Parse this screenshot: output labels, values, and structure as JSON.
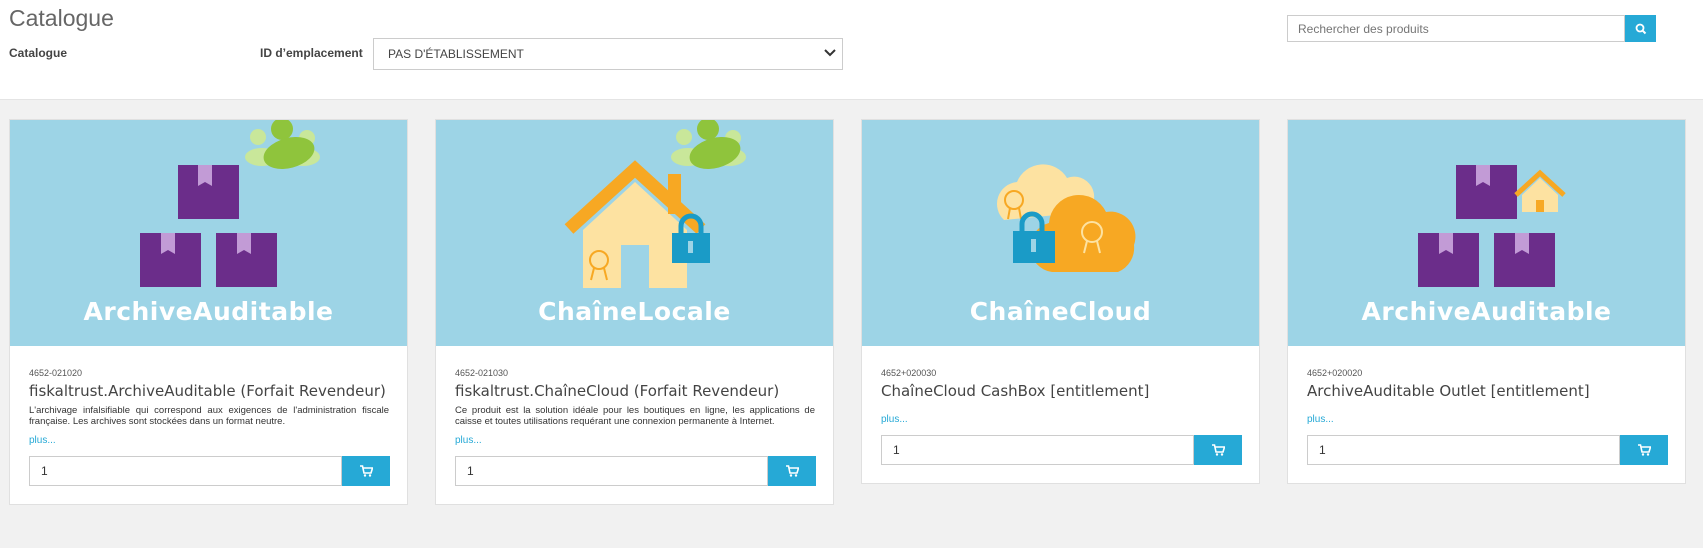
{
  "header": {
    "title": "Catalogue",
    "filter_label": "Catalogue",
    "location_label": "ID d’emplacement",
    "location_value": "PAS D'ÉTABLISSEMENT"
  },
  "search": {
    "placeholder": "Rechercher des produits"
  },
  "products": [
    {
      "image_caption": "ArchiveAuditable",
      "sku": "4652-021020",
      "name": "fiskaltrust.ArchiveAuditable (Forfait Revendeur)",
      "description": "L'archivage infalsifiable qui correspond aux exigences de l'administration fiscale française. Les archives sont stockées dans un format neutre.",
      "more": "plus...",
      "quantity": "1"
    },
    {
      "image_caption": "ChaîneLocale",
      "sku": "4652-021030",
      "name": "fiskaltrust.ChaîneCloud (Forfait Revendeur)",
      "description": "Ce produit est la solution idéale pour les boutiques en ligne, les applications de caisse et toutes utilisations requérant une connexion permanente à Internet.",
      "more": "plus...",
      "quantity": "1"
    },
    {
      "image_caption": "ChaîneCloud",
      "sku": "4652+020030",
      "name": "ChaîneCloud CashBox [entitlement]",
      "more": "plus...",
      "quantity": "1"
    },
    {
      "image_caption": "ArchiveAuditable",
      "sku": "4652+020020",
      "name": "ArchiveAuditable Outlet [entitlement]",
      "more": "plus...",
      "quantity": "1"
    }
  ],
  "colors": {
    "accent": "#26a9d6",
    "card_image_bg": "#9dd4e6",
    "box_purple": "#6b2d8a",
    "house_orange": "#f7a823",
    "lock_blue": "#1a9bc7",
    "people_green": "#8fc43c"
  }
}
